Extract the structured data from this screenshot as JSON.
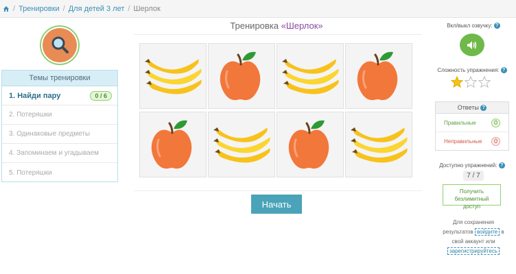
{
  "breadcrumb": {
    "items": [
      "Тренировки",
      "Для детей 3 лет"
    ],
    "current": "Шерлок"
  },
  "left": {
    "topics_title": "Темы тренировки",
    "topics": [
      {
        "label": "1. Найди пару",
        "badge": "0 / 6",
        "active": true
      },
      {
        "label": "2. Потеряшки"
      },
      {
        "label": "3. Одинаковые предметы"
      },
      {
        "label": "4. Запоминаем и угадываем"
      },
      {
        "label": "5. Потеряшки"
      }
    ]
  },
  "center": {
    "title_prefix": "Тренировка ",
    "title_name": "«Шерлок»",
    "cards": [
      "banana-icon",
      "apple-icon",
      "banana-icon",
      "apple-icon",
      "apple-icon",
      "banana-icon",
      "apple-icon",
      "banana-icon"
    ],
    "start_label": "Начать"
  },
  "right": {
    "sound_label": "Вкл/выкл озвучку:",
    "difficulty_label": "Сложность упражнения:",
    "difficulty_stars": 1,
    "difficulty_max": 3,
    "answers_title": "Ответы",
    "correct_label": "Правильные",
    "correct_count": "0",
    "wrong_label": "Неправильные",
    "wrong_count": "0",
    "available_label": "Доступно упражнений:",
    "available_count": "7 / 7",
    "access_line1": "Получить",
    "access_line2": "безлимитный доступ",
    "save_text1": "Для сохранения результатов",
    "login_link": "войдите",
    "save_text2": "в свой аккаунт или",
    "register_link": "зарегистрируйтесь"
  },
  "colors": {
    "accent": "#4aa3b8",
    "green": "#6fb84a",
    "purple": "#8b4aa0"
  }
}
